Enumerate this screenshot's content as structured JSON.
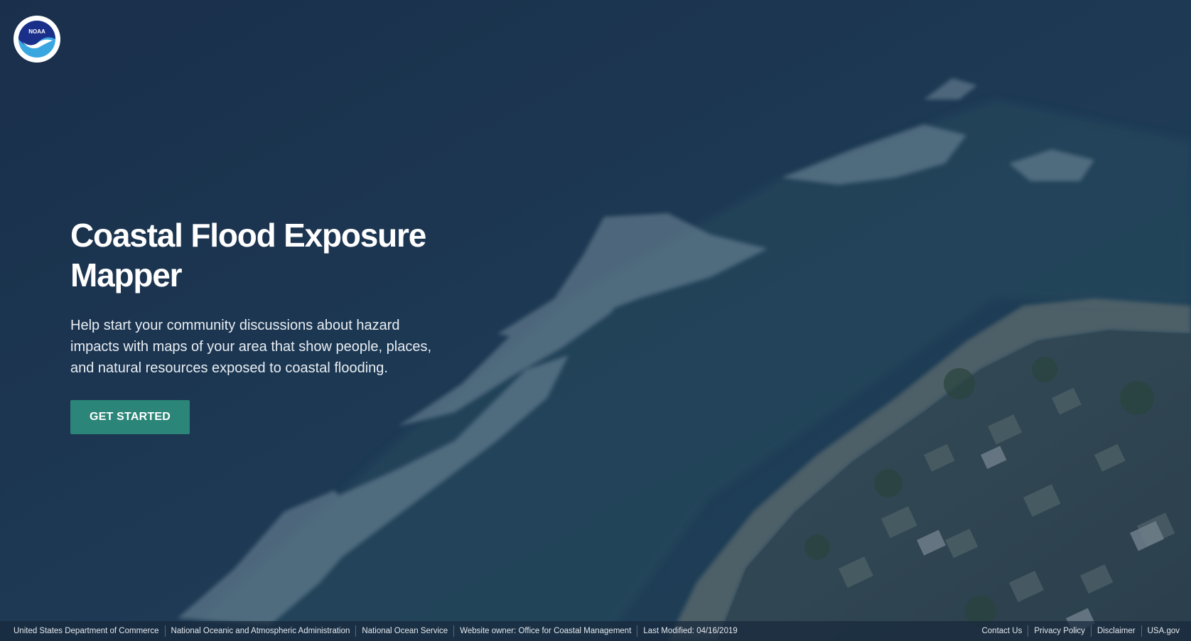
{
  "brand": {
    "logo_text": "NOAA",
    "colors": {
      "navy": "#1a2f8a",
      "sky": "#3aa6e0",
      "button": "#2b8579"
    }
  },
  "hero": {
    "title": "Coastal Flood Exposure Mapper",
    "description": "Help start your community discussions about hazard impacts with maps of your area that show people, places, and natural resources exposed to coastal flooding.",
    "cta_label": "GET STARTED"
  },
  "footer": {
    "left": [
      "United States Department of Commerce",
      "National Oceanic and Atmospheric Administration",
      "National Ocean Service",
      "Website owner: Office for Coastal Management",
      "Last Modified: 04/16/2019"
    ],
    "right": [
      "Contact Us",
      "Privacy Policy",
      "Disclaimer",
      "USA.gov"
    ]
  }
}
